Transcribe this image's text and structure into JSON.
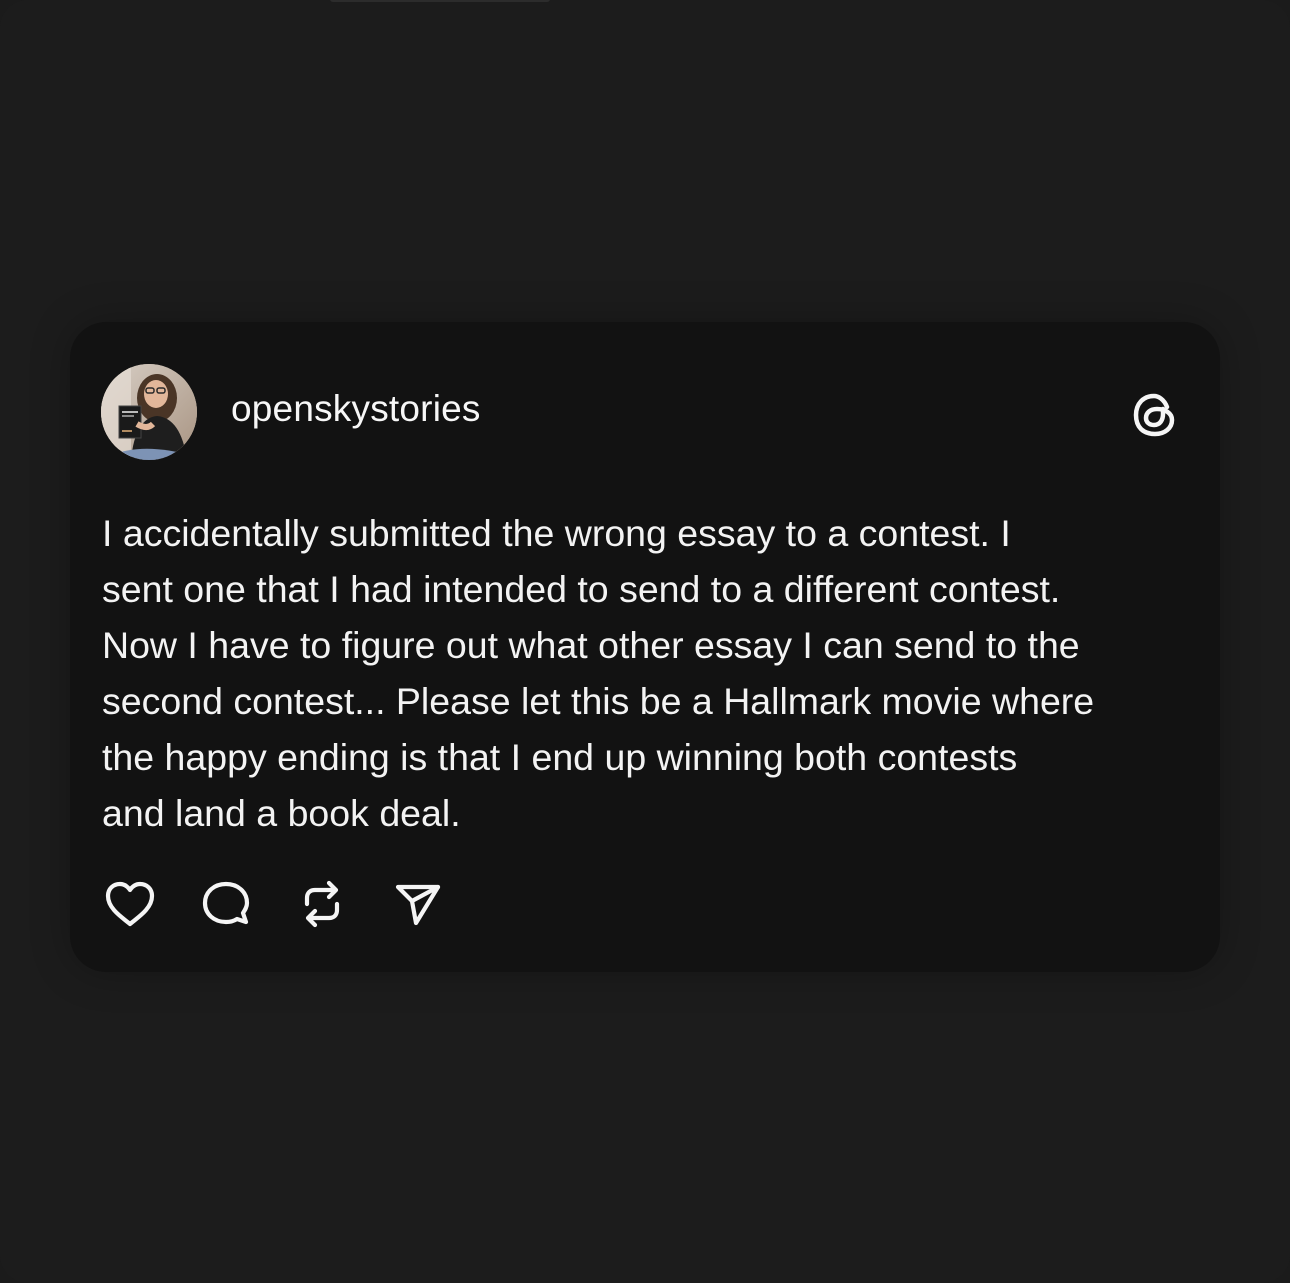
{
  "post": {
    "username": "openskystories",
    "text": "I accidentally submitted the wrong essay to a contest. I\nsent one that I had intended to send to a different contest.\nNow I have to figure out what other essay I can send to the\nsecond contest... Please let this be a Hallmark movie where\nthe happy ending is that I end up winning both contests\nand land a book deal."
  },
  "icons": {
    "brand": "threads-logo-icon",
    "like": "heart-icon",
    "reply": "comment-bubble-icon",
    "repost": "repost-icon",
    "share": "send-icon"
  },
  "colors": {
    "background": "#1c1c1c",
    "card": "#121212",
    "text": "#f3f3f3"
  }
}
